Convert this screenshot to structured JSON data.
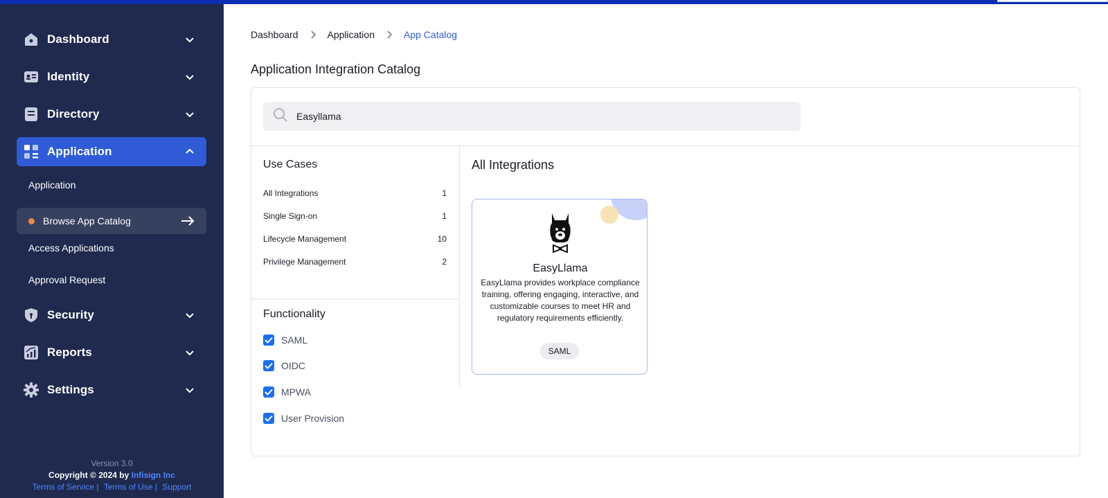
{
  "sidebar": {
    "items": [
      {
        "label": "Dashboard",
        "icon": "home-icon"
      },
      {
        "label": "Identity",
        "icon": "id-card-icon"
      },
      {
        "label": "Directory",
        "icon": "directory-icon"
      },
      {
        "label": "Application",
        "icon": "apps-grid-icon",
        "expanded": true
      },
      {
        "label": "Security",
        "icon": "shield-icon"
      },
      {
        "label": "Reports",
        "icon": "reports-icon"
      },
      {
        "label": "Settings",
        "icon": "gear-icon"
      }
    ],
    "subitems": [
      {
        "label": "Application"
      },
      {
        "label": "Browse App Catalog",
        "active": true
      },
      {
        "label": "Access Applications"
      },
      {
        "label": "Approval Request"
      }
    ],
    "footer": {
      "version": "Version 3.0",
      "copyright": "Copyright © 2024 by",
      "brand": "Infisign Inc",
      "links": [
        "Terms of Service |",
        "Terms of Use |",
        "Support"
      ]
    },
    "colors": {
      "background": "#1f2a4e",
      "active": "#2f5bd6",
      "accent_dot": "#f08a3c"
    }
  },
  "breadcrumb": [
    "Dashboard",
    "Application",
    "App Catalog"
  ],
  "page_title": "Application Integration Catalog",
  "search": {
    "value": "Easyllama",
    "icon": "search-icon"
  },
  "use_cases": {
    "title": "Use Cases",
    "items": [
      {
        "label": "All Integrations",
        "count": "1"
      },
      {
        "label": "Single Sign-on",
        "count": "1"
      },
      {
        "label": "Lifecycle Management",
        "count": "10"
      },
      {
        "label": "Privilege Management",
        "count": "2"
      }
    ]
  },
  "functionality": {
    "title": "Functionality",
    "items": [
      {
        "label": "SAML",
        "checked": true
      },
      {
        "label": "OIDC",
        "checked": true
      },
      {
        "label": "MPWA",
        "checked": true
      },
      {
        "label": "User Provision",
        "checked": true
      }
    ]
  },
  "integrations": {
    "title": "All Integrations",
    "cards": [
      {
        "name": "EasyLlama",
        "logo": "llama-logo-icon",
        "description": "EasyLlama provides workplace compliance training, offering engaging, interactive, and customizable courses to meet HR and regulatory requirements efficiently.",
        "tag": "SAML"
      }
    ]
  },
  "colors": {
    "topbar": "#0b2fb0",
    "link": "#2f5bd6",
    "checkbox": "#1a6ef5"
  }
}
